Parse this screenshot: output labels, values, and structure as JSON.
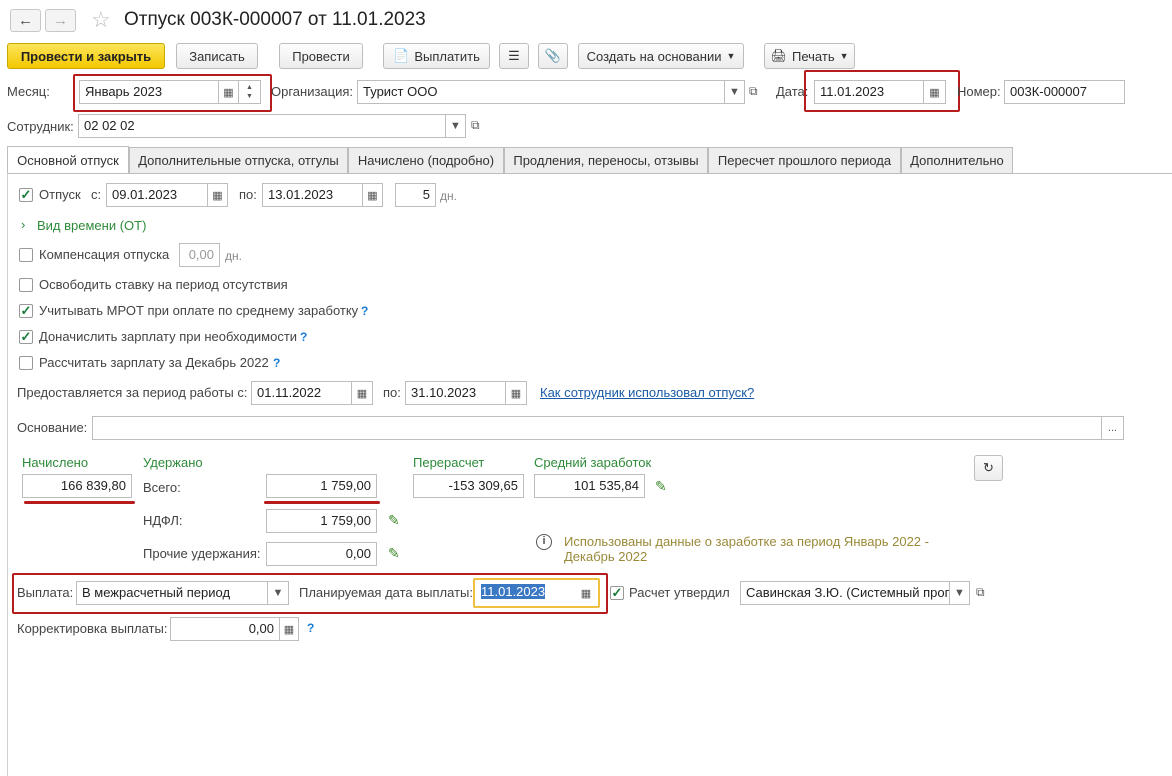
{
  "window": {
    "title": "Отпуск 003К-000007 от 11.01.2023"
  },
  "toolbar": {
    "post_close": "Провести и закрыть",
    "save": "Записать",
    "post": "Провести",
    "pay": "Выплатить",
    "create_based": "Создать на основании",
    "print": "Печать"
  },
  "header": {
    "month_label": "Месяц:",
    "month_value": "Январь 2023",
    "org_label": "Организация:",
    "org_value": "Турист ООО",
    "date_label": "Дата:",
    "date_value": "11.01.2023",
    "number_label": "Номер:",
    "number_value": "003К-000007",
    "employee_label": "Сотрудник:",
    "employee_value": "02 02 02"
  },
  "tabs": [
    {
      "label": "Основной отпуск"
    },
    {
      "label": "Дополнительные отпуска, отгулы"
    },
    {
      "label": "Начислено (подробно)"
    },
    {
      "label": "Продления, переносы, отзывы"
    },
    {
      "label": "Пересчет прошлого периода"
    },
    {
      "label": "Дополнительно"
    }
  ],
  "main": {
    "vacation_label": "Отпуск",
    "from_label": "с:",
    "from_value": "09.01.2023",
    "to_label": "по:",
    "to_value": "13.01.2023",
    "days_value": "5",
    "days_unit": "дн.",
    "time_kind": "Вид времени (ОТ)",
    "compensation_label": "Компенсация отпуска",
    "compensation_value": "0,00",
    "compensation_unit": "дн.",
    "release_rate": "Освободить ставку на период отсутствия",
    "mrot": "Учитывать МРОТ при оплате по среднему заработку",
    "additional_salary": "Доначислить зарплату при необходимости",
    "calc_salary": "Рассчитать зарплату за Декабрь 2022",
    "q_mark": "?",
    "period_label": "Предоставляется за период работы с:",
    "period_from": "01.11.2022",
    "period_to_label": "по:",
    "period_to": "31.10.2023",
    "usage_link": "Как сотрудник использовал отпуск?",
    "basis_label": "Основание:",
    "basis_value": "",
    "basis_btn": "..."
  },
  "totals": {
    "accrued_label": "Начислено",
    "accrued_value": "166 839,80",
    "withheld_label": "Удержано",
    "total_label": "Всего:",
    "total_value": "1 759,00",
    "ndfl_label": "НДФЛ:",
    "ndfl_value": "1 759,00",
    "other_label": "Прочие удержания:",
    "other_value": "0,00",
    "recalc_label": "Перерасчет",
    "recalc_value": "-153 309,65",
    "avg_label": "Средний заработок",
    "avg_value": "101 535,84",
    "info_line1": "Использованы данные о заработке за период Январь 2022 -",
    "info_line2": "Декабрь 2022"
  },
  "payment": {
    "label": "Выплата:",
    "value": "В межрасчетный период",
    "planned_label": "Планируемая дата выплаты:",
    "planned_value": "11.01.2023",
    "approved_label": "Расчет утвердил",
    "approver_value": "Савинская З.Ю. (Системный прог",
    "correction_label": "Корректировка выплаты:",
    "correction_value": "0,00"
  },
  "colors": {
    "accent": "#f3c800",
    "highlight": "#b71c1c",
    "label_green": "#2e8b3a"
  }
}
